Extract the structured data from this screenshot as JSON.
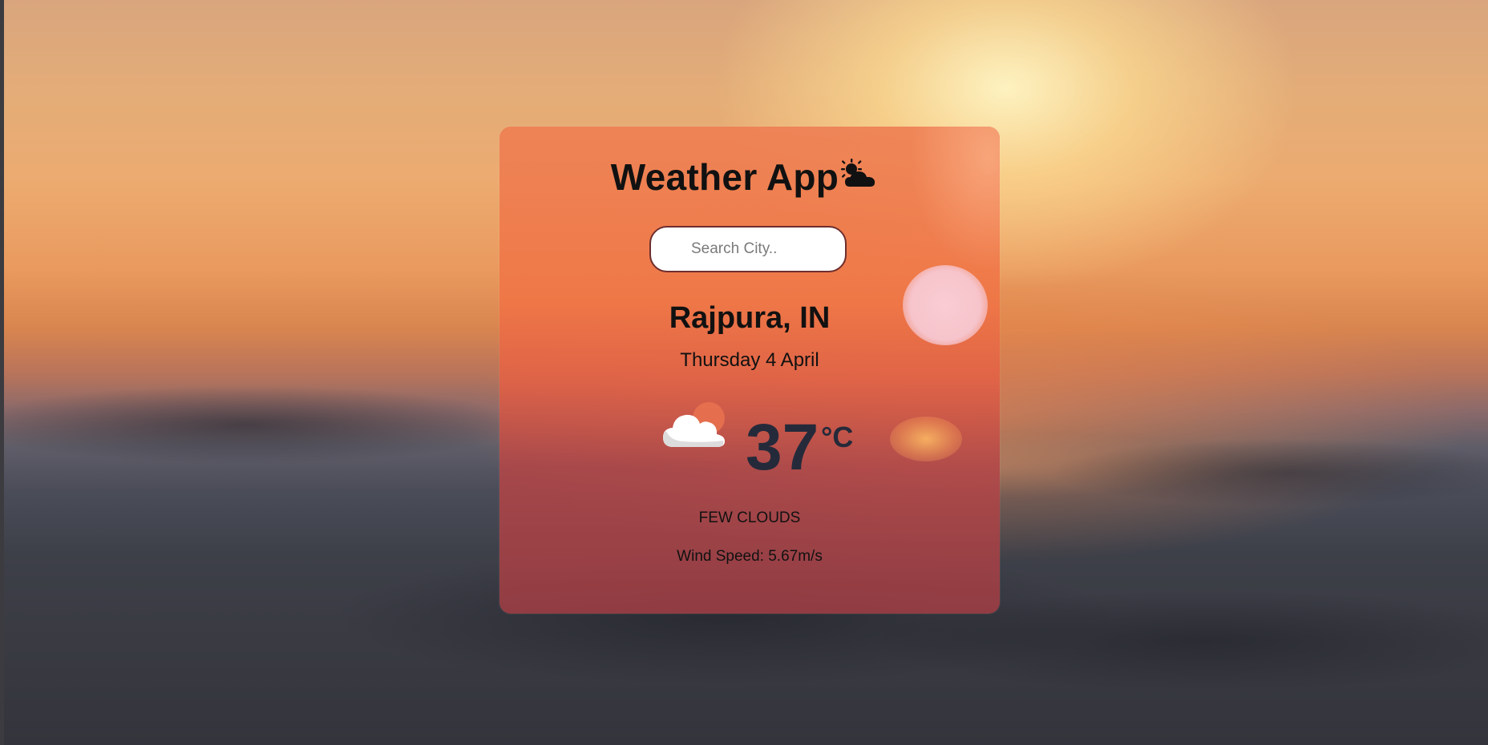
{
  "app": {
    "title": "Weather App",
    "title_icon": "sun-behind-cloud-icon"
  },
  "search": {
    "placeholder": "Search City..",
    "value": ""
  },
  "location": {
    "city": "Rajpura, IN",
    "date": "Thursday 4 April"
  },
  "current": {
    "condition_icon": "cloud-icon",
    "temperature": "37",
    "unit": "°C",
    "description": "FEW CLOUDS",
    "wind_speed": "Wind Speed: 5.67m/s"
  },
  "colors": {
    "card_tint": "#ee8054",
    "temp_text": "#252a3a",
    "search_border": "#6e2e2e"
  }
}
